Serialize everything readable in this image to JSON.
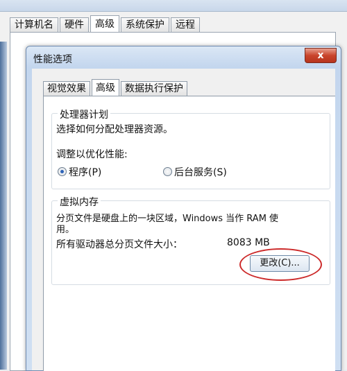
{
  "background_window": {
    "tabs": [
      "计算机名",
      "硬件",
      "高级",
      "系统保护",
      "远程"
    ],
    "active_tab_index": 2
  },
  "dialog": {
    "title": "性能选项",
    "close_label": "x",
    "tabs": [
      "视觉效果",
      "高级",
      "数据执行保护"
    ],
    "active_tab_index": 1,
    "processor": {
      "legend": "处理器计划",
      "description": "选择如何分配处理器资源。",
      "adjust_label": "调整以优化性能:",
      "options": [
        "程序(P)",
        "后台服务(S)"
      ],
      "selected_option_index": 0
    },
    "virtual_memory": {
      "legend": "虚拟内存",
      "description_line1": "分页文件是硬盘上的一块区域，Windows 当作 RAM 使",
      "description_line2": "用。",
      "total_label": "所有驱动器总分页文件大小：",
      "total_value": "8083 MB",
      "change_button": "更改(C)..."
    }
  },
  "colors": {
    "annotation": "#cc2a2a",
    "title_gradient_top": "#dbe7f5",
    "close_button": "#c9452c"
  }
}
